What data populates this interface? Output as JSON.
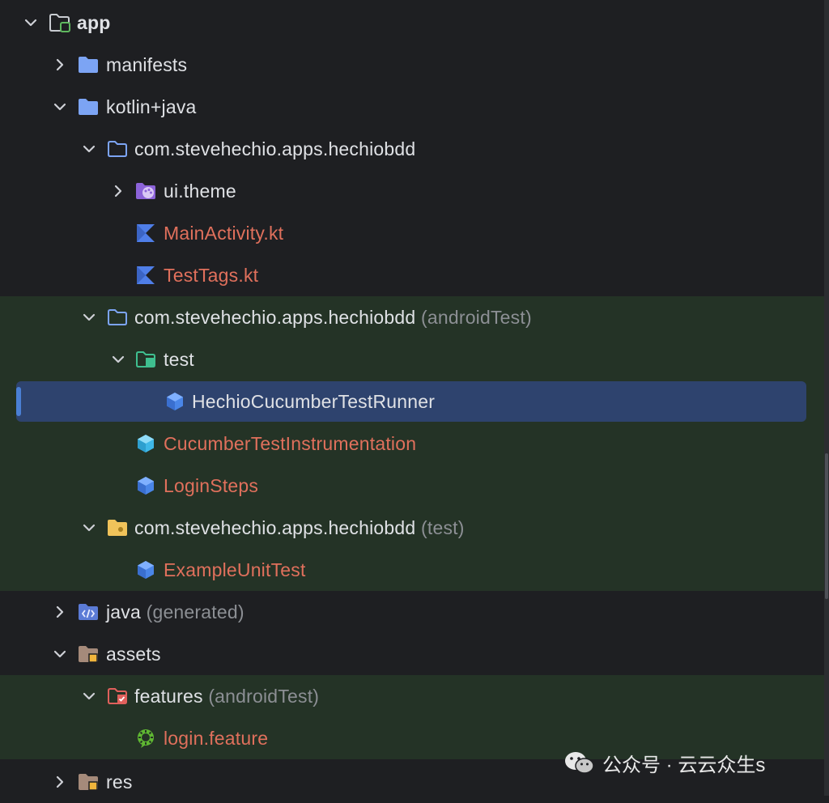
{
  "tree": {
    "app": {
      "label": "app"
    },
    "manifests": {
      "label": "manifests"
    },
    "kotlin_java": {
      "label": "kotlin+java"
    },
    "pkg_main": {
      "label": "com.stevehechio.apps.hechiobdd"
    },
    "ui_theme": {
      "label": "ui.theme"
    },
    "main_activity": {
      "label": "MainActivity.kt"
    },
    "test_tags": {
      "label": "TestTags.kt"
    },
    "pkg_android_test": {
      "label": "com.stevehechio.apps.hechiobdd",
      "suffix": "(androidTest)"
    },
    "test_pkg": {
      "label": "test"
    },
    "runner": {
      "label": "HechioCucumberTestRunner"
    },
    "instrumentation": {
      "label": "CucumberTestInstrumentation"
    },
    "login_steps": {
      "label": "LoginSteps"
    },
    "pkg_unit_test": {
      "label": "com.stevehechio.apps.hechiobdd",
      "suffix": "(test)"
    },
    "example_unit_test": {
      "label": "ExampleUnitTest"
    },
    "java_generated": {
      "label": "java",
      "suffix": "(generated)"
    },
    "assets": {
      "label": "assets"
    },
    "features": {
      "label": "features",
      "suffix": "(androidTest)"
    },
    "login_feature": {
      "label": "login.feature"
    },
    "res": {
      "label": "res"
    }
  },
  "watermark": {
    "text": "公众号 · 云云众生s"
  },
  "colors": {
    "background": "#1e1f22",
    "test_source_bg": "#243326",
    "selection": "#2e436e",
    "modified_file": "#e0705c",
    "folder_blue": "#7ca4f4",
    "kotlin": "#4f7ee8"
  }
}
